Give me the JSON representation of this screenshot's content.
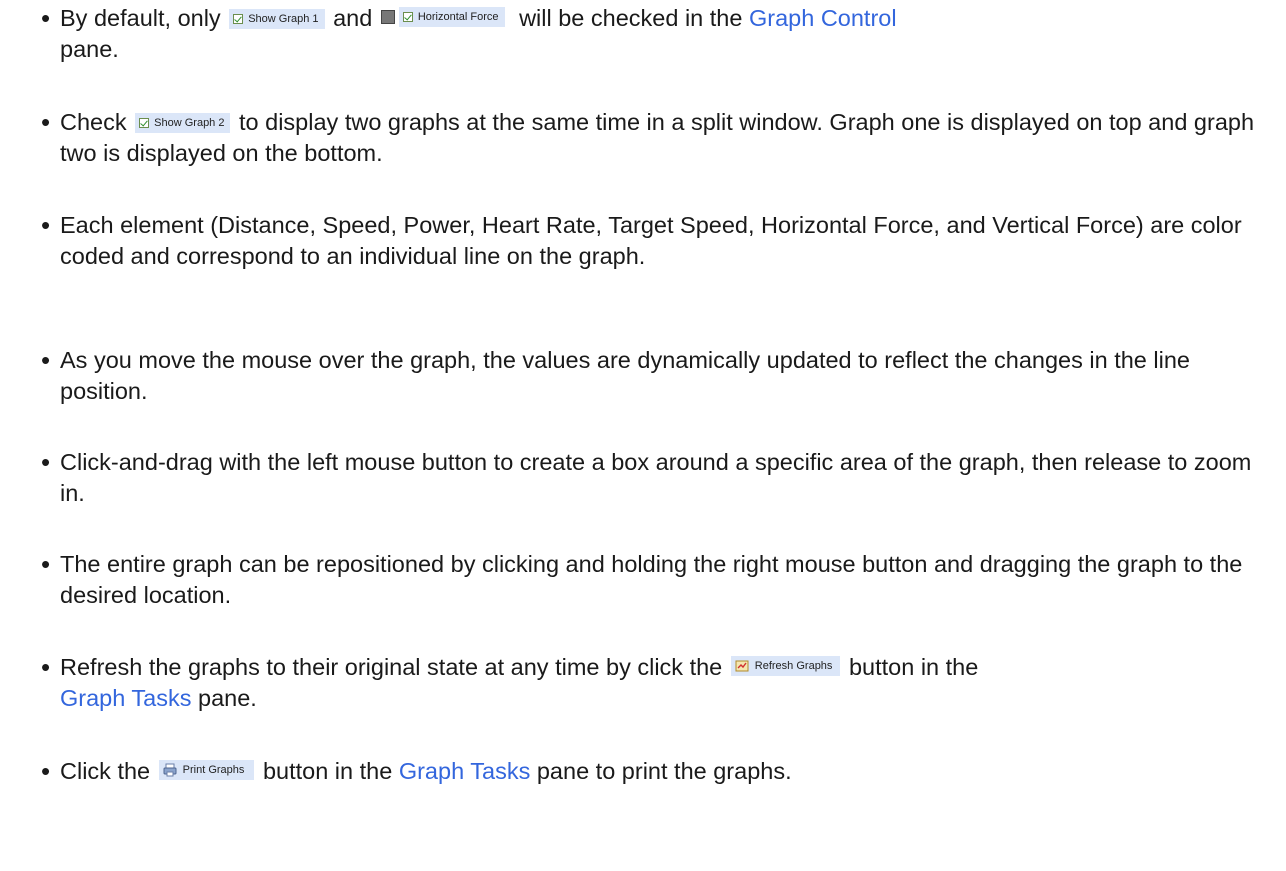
{
  "bullet": "•",
  "items": [
    {
      "t1": "By default, only",
      "chip1": "Show Graph 1",
      "t2": "and",
      "chip2": "Horizontal Force",
      "t3": "will be checked in the",
      "link": "Graph Control",
      "t4": "pane."
    },
    {
      "t1": "Check",
      "chip": "Show Graph 2",
      "t2": "to display two graphs at the same time in a split window. Graph one is displayed on top and graph two is displayed on the bottom."
    },
    {
      "text": "Each element (Distance, Speed, Power, Heart Rate, Target Speed, Horizontal Force, and Vertical Force) are color coded and correspond to an individual line on the graph."
    },
    {
      "text": "As you move the mouse over the graph, the values are dynamically updated to reflect the changes in the line position."
    },
    {
      "text": "Click-and-drag with the left mouse button to create a box around a specific area of the graph, then release to zoom in."
    },
    {
      "text": "The entire graph can be repositioned by clicking and holding the right mouse button and dragging the graph to the desired location."
    },
    {
      "t1": "Refresh the graphs to their original state at any time by click the",
      "button": "Refresh Graphs",
      "t2": "button in the",
      "link": "Graph Tasks",
      "t3": "pane."
    },
    {
      "t1": "Click the",
      "button": "Print Graphs",
      "t2": "button in the",
      "link": "Graph Tasks",
      "t3": "pane to print the graphs."
    }
  ],
  "colors": {
    "link": "#3366dd",
    "chip_bg": "#dbe6f8",
    "check": "#2f8f2f",
    "swatch": "#777777"
  },
  "icons": {
    "checkbox": "checked-checkbox-icon",
    "swatch": "gray-color-swatch-icon",
    "refresh": "refresh-graphs-icon",
    "print": "printer-icon"
  }
}
